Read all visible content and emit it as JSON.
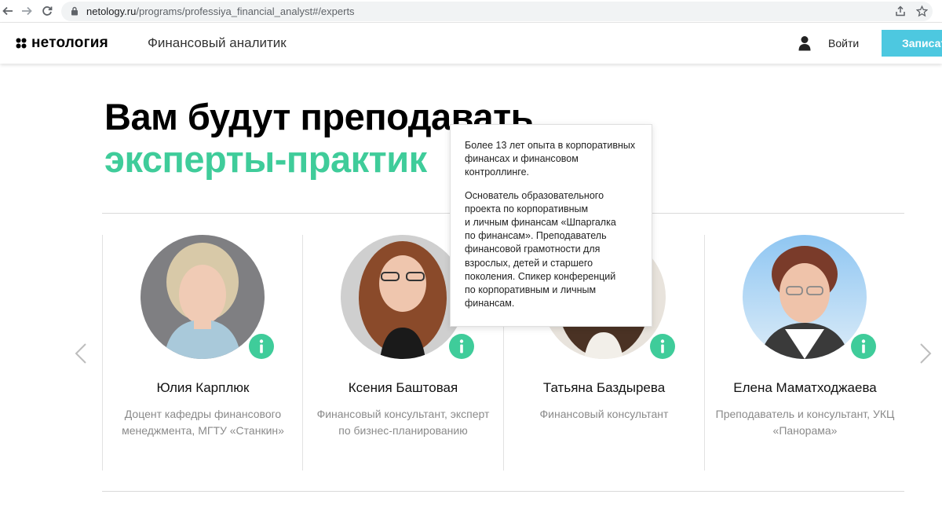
{
  "browser": {
    "url_host": "netology.ru",
    "url_path": "/programs/professiya_financial_analyst#/experts"
  },
  "header": {
    "logo_text": "нетология",
    "course_name": "Финансовый аналитик",
    "login_label": "Войти",
    "signup_label": "Записат"
  },
  "headline": {
    "line1": "Вам будут преподавать",
    "line2": "эксперты-практик"
  },
  "experts": [
    {
      "name": "Юлия Карплюк",
      "description": "Доцент кафедры финансового менеджмента, МГТУ «Станкин»"
    },
    {
      "name": "Ксения Баштовая",
      "description": "Финансовый консультант, эксперт по бизнес-планированию"
    },
    {
      "name": "Татьяна Баздырева",
      "description": "Финансовый консультант"
    },
    {
      "name": "Елена Маматходжаева",
      "description": "Преподаватель и консультант, УКЦ «Панорама»"
    }
  ],
  "tooltip": {
    "paragraph1": "Более 13 лет опыта в корпоративных\nфинансах и финансовом\nконтроллинге.",
    "paragraph2": "Основатель образовательного\nпроекта по корпоративным\nи личным финансам «Шпаргалка\nпо финансам». Преподаватель\nфинансовой грамотности для\nвзрослых, детей и старшего\nпоколения. Спикер конференций\nпо корпоративным и личным\nфинансам."
  },
  "icons": {
    "back": "arrow-left-icon",
    "forward": "arrow-right-icon",
    "reload": "reload-icon",
    "lock": "lock-icon",
    "share": "share-icon",
    "bookmark": "star-icon",
    "user": "user-icon",
    "info": "info-icon",
    "prev": "chevron-left-icon",
    "next": "chevron-right-icon"
  },
  "colors": {
    "accent_green": "#3fcc9a",
    "signup_blue": "#4dc8e0"
  }
}
